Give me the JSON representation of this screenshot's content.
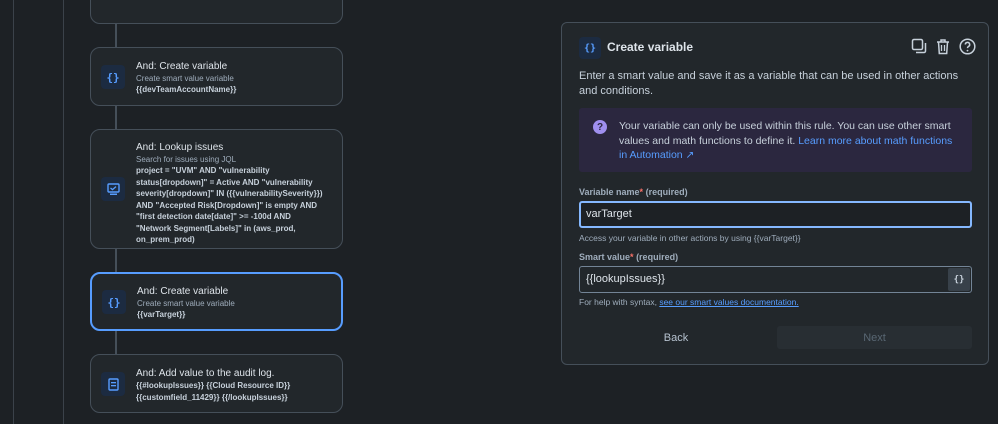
{
  "cards": [
    {
      "title": "And: Create variable",
      "subtitle": "Create smart value variable",
      "code": "{{devTeamAccountName}}",
      "icon": "braces-icon"
    },
    {
      "title": "And: Lookup issues",
      "subtitle": "Search for issues using JQL",
      "code": "project = \"UVM\" AND \"vulnerability status[dropdown]\" = Active AND \"vulnerability severity[dropdown]\" IN ({{vulnerabilitySeverity}}) AND \"Accepted Risk[Dropdown]\" is empty AND \"first detection date[date]\" >= -100d AND \"Network Segment[Labels]\" in (aws_prod, on_prem_prod)",
      "icon": "lookup-issues-icon"
    },
    {
      "title": "And: Create variable",
      "subtitle": "Create smart value variable",
      "code": "{{varTarget}}",
      "icon": "braces-icon"
    },
    {
      "title": "And: Add value to the audit log.",
      "code": "{{#lookupIssues}} {{Cloud Resource ID}} {{customfield_11429}} {{/lookupIssues}}",
      "icon": "audit-log-icon"
    }
  ],
  "panel": {
    "icon_text": "{}",
    "title": "Create variable",
    "description": "Enter a smart value and save it as a variable that can be used in other actions and conditions.",
    "info_text": "Your variable can only be used within this rule. You can use other smart values and math functions to define it. ",
    "info_link": "Learn more about math functions in Automation ↗",
    "name_label": "Variable name",
    "required_star": "*",
    "required_text": "(required)",
    "name_value": "varTarget",
    "name_help": "Access your variable in other actions by using {{varTarget}}",
    "smart_label": "Smart value",
    "smart_value": "{{lookupIssues}}",
    "smart_btn": "{}",
    "smart_help": "For help with syntax, ",
    "smart_help_link": "see our smart values documentation.",
    "back_label": "Back",
    "next_label": "Next"
  },
  "colors": {
    "background": "#1d2125",
    "accent": "#579dff",
    "info_bg": "#2b273f",
    "required": "#f87168"
  }
}
